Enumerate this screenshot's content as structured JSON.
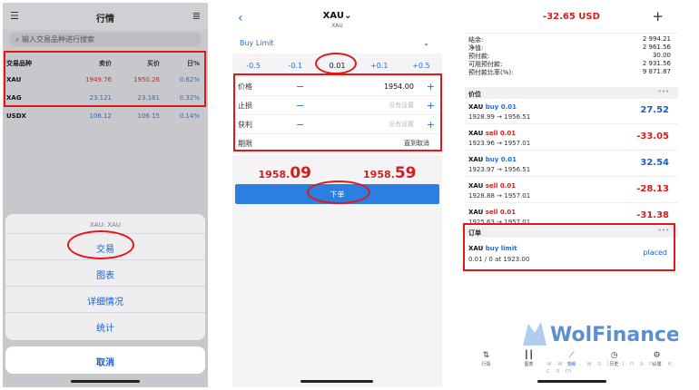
{
  "panel1": {
    "title": "行情",
    "search_placeholder": "输入交易品种进行搜索",
    "columns": [
      "交易品种",
      "卖价",
      "买价",
      "日%"
    ],
    "rows": [
      {
        "symbol": "XAU",
        "bid": "1949.76",
        "ask": "1950.26",
        "change": "0.62%"
      },
      {
        "symbol": "XAG",
        "bid": "23.121",
        "ask": "23.161",
        "change": "0.32%"
      },
      {
        "symbol": "USDX",
        "bid": "106.12",
        "ask": "106.15",
        "change": "0.14%"
      }
    ],
    "sheet_title": "XAU: XAU",
    "options": [
      "交易",
      "图表",
      "详细情况",
      "统计"
    ],
    "cancel": "取消"
  },
  "panel2": {
    "symbol": "XAU",
    "symbol_sub": "XAU",
    "order_type": "Buy Limit",
    "volume_steps": [
      "-0.5",
      "-0.1",
      "0.01",
      "+0.1",
      "+0.5"
    ],
    "fields": {
      "price_label": "价格",
      "price_value": "1954.00",
      "sl_label": "止损",
      "sl_placeholder": "没有设置",
      "tp_label": "获利",
      "tp_placeholder": "没有设置",
      "expiry_label": "期限",
      "expiry_value": "直到取消"
    },
    "bid_prefix": "1958.",
    "bid_big": "09",
    "ask_prefix": "1958.",
    "ask_big": "59",
    "place_label": "下单"
  },
  "panel3": {
    "profit": "-32.65 USD",
    "account": [
      {
        "label": "结余:",
        "value": "2 994.21"
      },
      {
        "label": "净值:",
        "value": "2 961.56"
      },
      {
        "label": "预付款:",
        "value": "30.00"
      },
      {
        "label": "可用预付款:",
        "value": "2 931.56"
      },
      {
        "label": "预付款比率(%):",
        "value": "9 871.87"
      }
    ],
    "positions_header": "价位",
    "positions": [
      {
        "symbol": "XAU",
        "side": "buy 0.01",
        "prices": "1928.99 → 1956.51",
        "pl": "27.52",
        "pl_color": "#1a5fce",
        "side_color": "#1a6fdc"
      },
      {
        "symbol": "XAU",
        "side": "sell 0.01",
        "prices": "1923.96 → 1957.01",
        "pl": "-33.05",
        "pl_color": "#d01f1f",
        "side_color": "#d01f1f"
      },
      {
        "symbol": "XAU",
        "side": "buy 0.01",
        "prices": "1923.97 → 1956.51",
        "pl": "32.54",
        "pl_color": "#1a5fce",
        "side_color": "#1a6fdc"
      },
      {
        "symbol": "XAU",
        "side": "sell 0.01",
        "prices": "1928.88 → 1957.01",
        "pl": "-28.13",
        "pl_color": "#d01f1f",
        "side_color": "#d01f1f"
      },
      {
        "symbol": "XAU",
        "side": "sell 0.01",
        "prices": "1925.63 → 1957.01",
        "pl": "-31.38",
        "pl_color": "#d01f1f",
        "side_color": "#d01f1f"
      }
    ],
    "orders_header": "订单",
    "order": {
      "symbol": "XAU",
      "type": "buy limit",
      "detail": "0.01 / 0 at 1923.00",
      "status": "placed"
    },
    "tabs": [
      "行情",
      "图表",
      "交易",
      "历史",
      "设置"
    ],
    "watermark": "WolFinance",
    "watermark_url": "w w w . w o l f i n a n c e . c o m"
  }
}
